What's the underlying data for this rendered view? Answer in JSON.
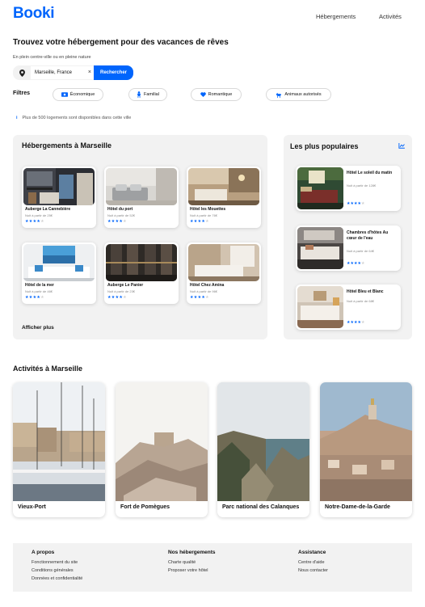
{
  "header": {
    "logo": "Booki",
    "nav": [
      "Hébergements",
      "Activités"
    ]
  },
  "hero": {
    "title": "Trouvez votre hébergement pour des vacances de rêves",
    "subtitle": "En plein centre-ville ou en pleine nature"
  },
  "search": {
    "value": "Marseille, France",
    "clear": "×",
    "button": "Rechercher",
    "icon": "location-pin-icon"
  },
  "filters": {
    "label": "Filtres",
    "items": [
      {
        "label": "Économique",
        "icon": "money-icon"
      },
      {
        "label": "Familial",
        "icon": "child-icon"
      },
      {
        "label": "Romantique",
        "icon": "heart-icon"
      },
      {
        "label": "Animaux autorisés",
        "icon": "dog-icon"
      }
    ]
  },
  "info": {
    "icon": "i",
    "text": "Plus de 500 logements sont disponibles dans cette ville"
  },
  "lodgings": {
    "title": "Hébergements à Marseille",
    "more": "Afficher plus",
    "items": [
      {
        "name": "Auberge La Cannebière",
        "price": "Nuit à partir de 25€",
        "rating": 4
      },
      {
        "name": "Hôtel du port",
        "price": "Nuit à partir de 52€",
        "rating": 4
      },
      {
        "name": "Hôtel les Mouettes",
        "price": "Nuit à partir de 76€",
        "rating": 4
      },
      {
        "name": "Hôtel de la mer",
        "price": "Nuit à partir de 46€",
        "rating": 4
      },
      {
        "name": "Auberge Le Panier",
        "price": "Nuit à partir de 23€",
        "rating": 4
      },
      {
        "name": "Hôtel Chez Amina",
        "price": "Nuit à partir de 96€",
        "rating": 4
      }
    ]
  },
  "popular": {
    "title": "Les plus populaires",
    "icon": "trend-chart-icon",
    "items": [
      {
        "name": "Hôtel Le soleil du matin",
        "price": "Nuit à partir de 128€",
        "rating": 4
      },
      {
        "name": "Chambres d'hôtes Au cœur de l'eau",
        "price": "Nuit à partir de 64€",
        "rating": 4
      },
      {
        "name": "Hôtel Bleu et Blanc",
        "price": "Nuit à partir de 68€",
        "rating": 4
      }
    ]
  },
  "activities": {
    "title": "Activités à Marseille",
    "items": [
      "Vieux-Port",
      "Fort de Pomègues",
      "Parc national des Calanques",
      "Notre-Dame-de-la-Garde"
    ]
  },
  "footer": {
    "columns": [
      {
        "title": "A propos",
        "links": [
          "Fonctionnement du site",
          "Conditions générales",
          "Données et confidentialité"
        ]
      },
      {
        "title": "Nos hébergements",
        "links": [
          "Charte qualité",
          "Proposer votre hôtel"
        ]
      },
      {
        "title": "Assistance",
        "links": [
          "Centre d'aide",
          "Nous contacter"
        ]
      }
    ]
  },
  "colors": {
    "accent": "#0065fc",
    "panel": "#f2f2f2"
  }
}
